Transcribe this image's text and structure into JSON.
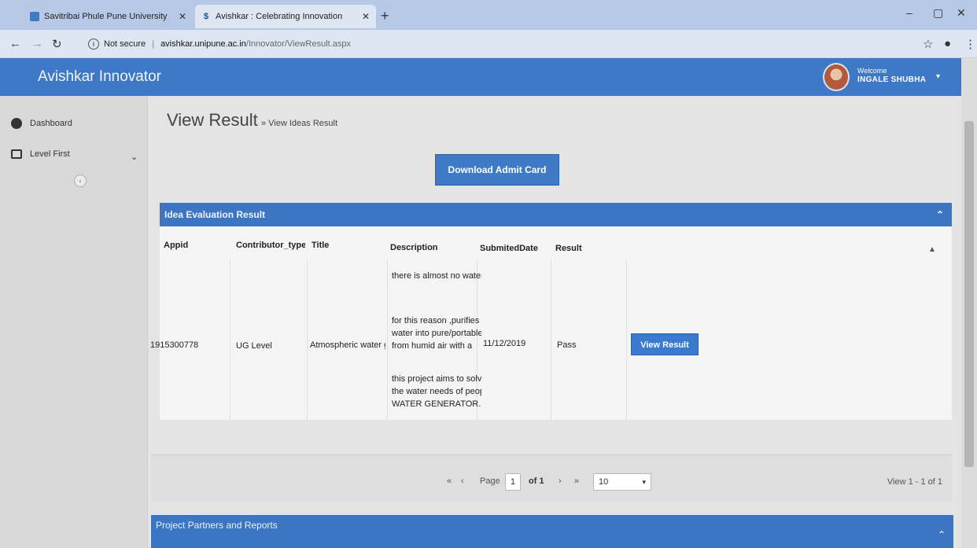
{
  "browser": {
    "tabs": [
      {
        "title": "Savitribai Phule Pune University",
        "active": false
      },
      {
        "title": "Avishkar : Celebrating Innovation",
        "active": true
      }
    ],
    "security_label": "Not secure",
    "url_host": "avishkar.unipune.ac.in",
    "url_path": "/Innovator/ViewResult.aspx"
  },
  "app": {
    "brand": "Avishkar Innovator",
    "welcome_label": "Welcome",
    "username": "INGALE SHUBHA"
  },
  "sidebar": {
    "items": [
      {
        "label": "Dashboard",
        "icon": "dashboard-icon"
      },
      {
        "label": "Level First",
        "icon": "monitor-icon"
      }
    ]
  },
  "page": {
    "title": "View Result",
    "breadcrumb": "» View Ideas Result",
    "download_label": "Download Admit Card"
  },
  "results_panel": {
    "title": "Idea Evaluation Result",
    "columns": [
      "Appid",
      "Contributor_type",
      "Title",
      "Description",
      "SubmitedDate",
      "Result"
    ],
    "row": {
      "appid": "1915300778",
      "contributor_type": "UG Level",
      "title": "Atmospheric water generator",
      "description": [
        "there is almost no water",
        "for this reason ,purifies",
        "water into pure/portable",
        "from humid air with a",
        "this project aims to solve",
        "the water needs of people",
        "WATER GENERATOR."
      ],
      "submitted_date": "11/12/2019",
      "result": "Pass",
      "action_label": "View Result"
    }
  },
  "pager": {
    "page_label": "Page",
    "page_value": "1",
    "of_label": "of 1",
    "page_size": "10",
    "view_count": "View 1 - 1 of 1"
  },
  "partners_panel": {
    "title": "Project Partners and Reports"
  }
}
